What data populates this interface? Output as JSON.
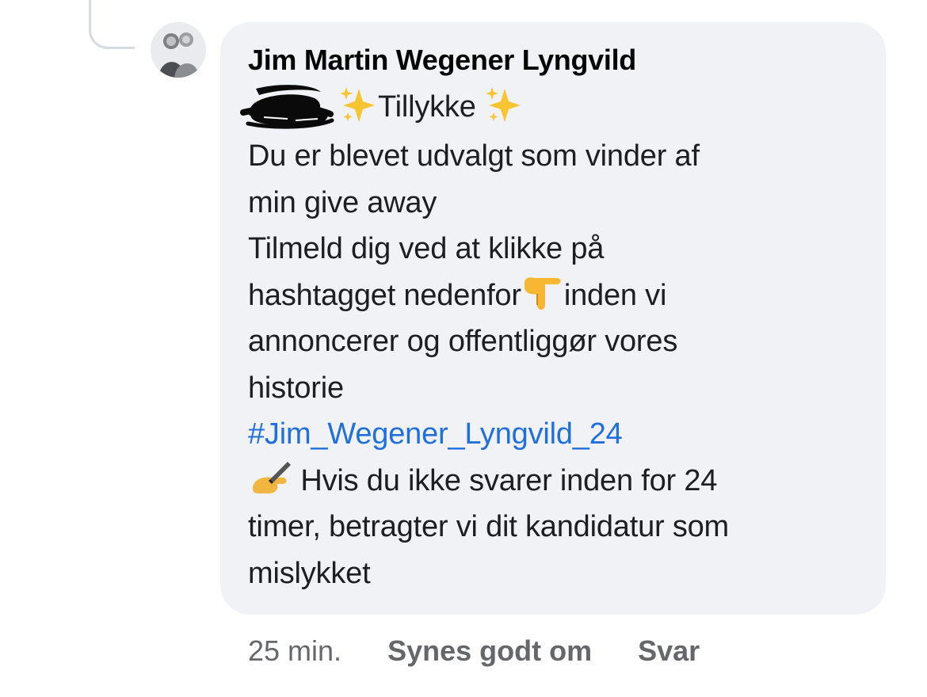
{
  "comment": {
    "author": "Jim Martin Wegener Lyngvild",
    "avatar_icon": "profile-photo-avatar",
    "mention_redacted": true,
    "line1_text": "Tillykke",
    "line2": "Du er blevet udvalgt som vinder af",
    "line3": "min give away",
    "line4": "Tilmeld dig ved at klikke på",
    "line5_a": "hashtagget nedenfor",
    "line5_b": "inden vi",
    "line6": "annoncerer og offentliggør vores",
    "line7": "historie",
    "hashtag": "#Jim_Wegener_Lyngvild_24",
    "line9": "Hvis du ikke svarer inden for 24",
    "line10": "timer, betragter vi dit kandidatur som",
    "line11": "mislykket",
    "icons": [
      "sparkles-icon",
      "pointing-down-icon",
      "writing-hand-icon"
    ]
  },
  "actions": {
    "timestamp": "25 min.",
    "like_label": "Synes godt om",
    "reply_label": "Svar"
  },
  "colors": {
    "bubble": "#f0f2f5",
    "hashtag": "#216fdb",
    "meta": "#65676b",
    "author": "#050505"
  }
}
